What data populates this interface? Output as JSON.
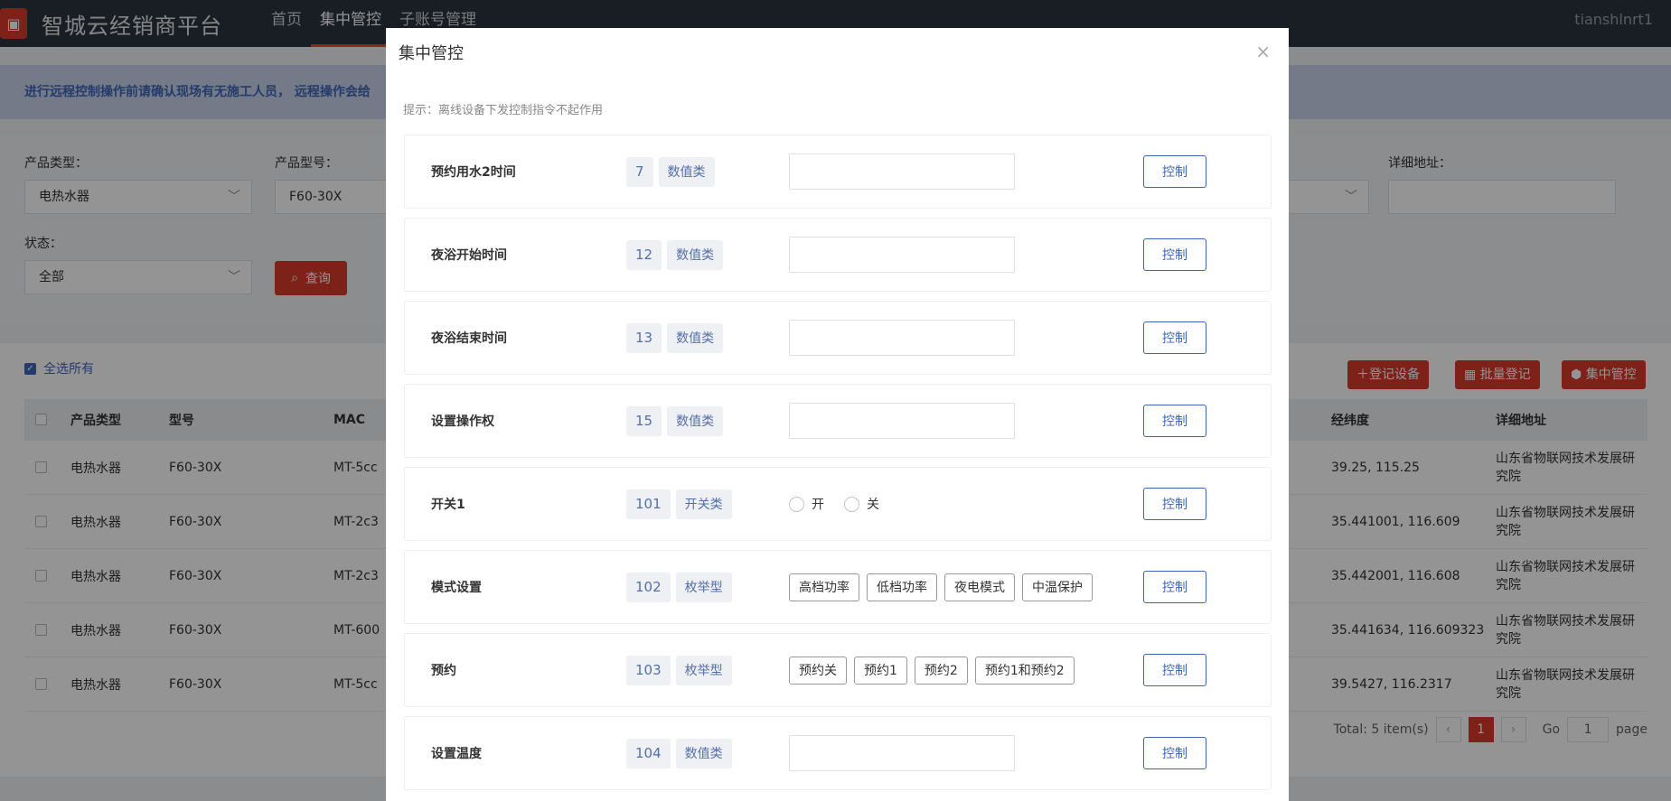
{
  "header": {
    "brand": "智城云经销商平台",
    "nav": [
      "首页",
      "集中管控",
      "子账号管理"
    ],
    "active_nav": 1,
    "user": "tianshlnrt1"
  },
  "notice": "进行远程控制操作前请确认现场有无施工人员， 远程操作会给",
  "filters": {
    "product_type_label": "产品类型：",
    "product_type_value": "电热水器",
    "model_label": "产品型号：",
    "model_value": "F60-30X",
    "address_label": "详细地址：",
    "status_label": "状态：",
    "status_value": "全部",
    "query_label": "查询"
  },
  "list": {
    "select_all": "全选所有",
    "register_btn": "登记设备",
    "batch_btn": "批量登记",
    "control_btn": "集中管控",
    "columns": [
      "产品类型",
      "型号",
      "MAC",
      "经纬度",
      "详细地址"
    ],
    "rows": [
      {
        "type": "电热水器",
        "model": "F60-30X",
        "mac": "MT-5cc",
        "coord": "39.25, 115.25",
        "addr": "山东省物联网技术发展研究院"
      },
      {
        "type": "电热水器",
        "model": "F60-30X",
        "mac": "MT-2c3",
        "coord": "35.441001, 116.609",
        "addr": "山东省物联网技术发展研究院"
      },
      {
        "type": "电热水器",
        "model": "F60-30X",
        "mac": "MT-2c3",
        "coord": "35.442001, 116.608",
        "addr": "山东省物联网技术发展研究院"
      },
      {
        "type": "电热水器",
        "model": "F60-30X",
        "mac": "MT-600",
        "coord": "35.441634, 116.609323",
        "addr": "山东省物联网技术发展研究院"
      },
      {
        "type": "电热水器",
        "model": "F60-30X",
        "mac": "MT-5cc",
        "coord": "39.5427, 116.2317",
        "addr": "山东省物联网技术发展研究院"
      }
    ],
    "pager": {
      "total": "Total: 5 item(s)",
      "current": "1",
      "go_label": "Go",
      "go_value": "1",
      "page_label": "page"
    }
  },
  "modal": {
    "title": "集中管控",
    "close": "×",
    "tip": "提示：离线设备下发控制指令不起作用",
    "control_label": "控制",
    "items": [
      {
        "name": "预约用水2时间",
        "id": "7",
        "kind": "数值类",
        "input": "number"
      },
      {
        "name": "夜浴开始时间",
        "id": "12",
        "kind": "数值类",
        "input": "number"
      },
      {
        "name": "夜浴结束时间",
        "id": "13",
        "kind": "数值类",
        "input": "number"
      },
      {
        "name": "设置操作权",
        "id": "15",
        "kind": "数值类",
        "input": "number"
      },
      {
        "name": "开关1",
        "id": "101",
        "kind": "开关类",
        "input": "switch",
        "options": [
          "开",
          "关"
        ]
      },
      {
        "name": "模式设置",
        "id": "102",
        "kind": "枚举型",
        "input": "enum",
        "options": [
          "高档功率",
          "低档功率",
          "夜电模式",
          "中温保护"
        ]
      },
      {
        "name": "预约",
        "id": "103",
        "kind": "枚举型",
        "input": "enum",
        "options": [
          "预约关",
          "预约1",
          "预约2",
          "预约1和预约2"
        ]
      },
      {
        "name": "设置温度",
        "id": "104",
        "kind": "数值类",
        "input": "number"
      }
    ]
  },
  "colors": {
    "header_bg": "#2b333e",
    "accent_red": "#d8392b",
    "primary_blue": "#3f66b8"
  }
}
